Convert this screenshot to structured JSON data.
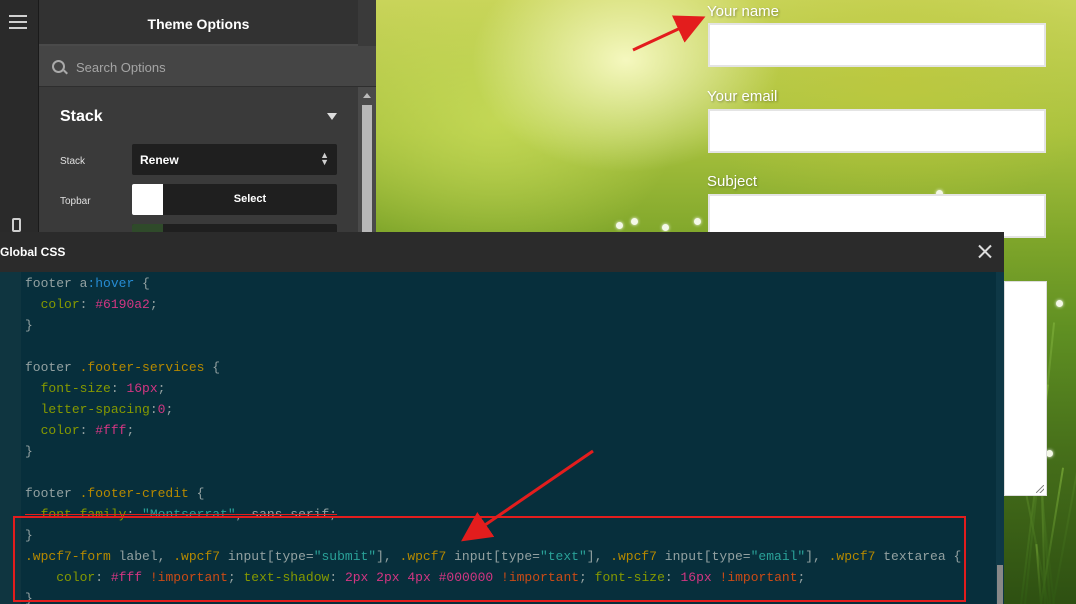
{
  "admin": {
    "panel_title": "Theme Options",
    "search_placeholder": "Search Options",
    "section_title": "Stack",
    "rows": [
      {
        "label": "Stack",
        "value": "Renew"
      },
      {
        "label": "Topbar",
        "button": "Select",
        "swatch_color": "#ffffff"
      }
    ]
  },
  "preview": {
    "fields": [
      "Your name",
      "Your email",
      "Subject"
    ]
  },
  "modal": {
    "title": "Global CSS",
    "code_lines": [
      "footer a:hover {",
      "  color: #6190a2;",
      "}",
      "",
      "footer .footer-services {",
      "  font-size: 16px;",
      "  letter-spacing:0;",
      "  color: #fff;",
      "}",
      "",
      "footer .footer-credit {",
      "  font-family: \"Montserrat\", sans-serif;",
      "}",
      ".wpcf7-form label, .wpcf7 input[type=\"submit\"], .wpcf7 input[type=\"text\"], .wpcf7 input[type=\"email\"], .wpcf7 textarea {",
      "    color: #fff !important; text-shadow: 2px 2px 4px #000000 !important; font-size: 16px !important;",
      "}"
    ]
  },
  "colors": {
    "annotation": "#e31d1d",
    "editor_bg": "#072f3c"
  }
}
